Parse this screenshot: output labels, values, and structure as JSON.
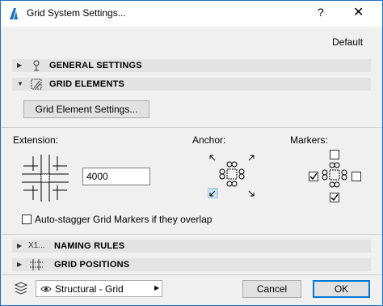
{
  "window": {
    "title": "Grid System Settings...",
    "help_label": "?",
    "close_label": "✕",
    "favorite_label": "Default"
  },
  "sections": {
    "general": {
      "label": "GENERAL SETTINGS"
    },
    "elements": {
      "label": "GRID ELEMENTS"
    },
    "naming": {
      "label": "NAMING RULES",
      "prefix": "X1..."
    },
    "positions": {
      "label": "GRID POSITIONS"
    }
  },
  "grid_elements": {
    "settings_button": "Grid Element Settings...",
    "extension_label": "Extension:",
    "extension_value": "4000",
    "anchor_label": "Anchor:",
    "markers_label": "Markers:",
    "auto_stagger_label": "Auto-stagger Grid Markers if they overlap",
    "auto_stagger_checked": false,
    "markers_checked": {
      "top": false,
      "left": true,
      "right": false,
      "bottom": true
    }
  },
  "footer": {
    "layer_value": "Structural - Grid",
    "cancel_label": "Cancel",
    "ok_label": "OK"
  },
  "colors": {
    "accent": "#0078d7",
    "section_bg": "#e3e3e3",
    "dialog_bg": "#f0f0f0"
  }
}
